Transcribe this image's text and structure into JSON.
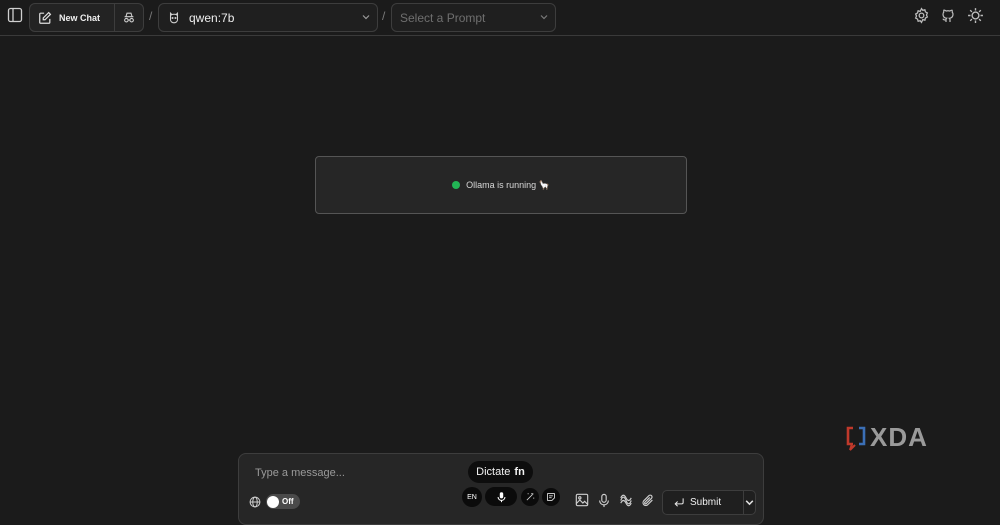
{
  "header": {
    "new_chat_label": "New Chat",
    "separator_1": "/",
    "separator_2": "/",
    "model": {
      "selected": "qwen:7b"
    },
    "prompt_select": {
      "placeholder": "Select a Prompt"
    },
    "right_icons": [
      "gear-icon",
      "github-icon",
      "settings-cog-icon"
    ]
  },
  "status": {
    "text": "Ollama is running 🦙",
    "indicator_color": "#22b455"
  },
  "watermark": {
    "text": "XDA"
  },
  "composer": {
    "placeholder": "Type a message...",
    "web_search_toggle": {
      "label": "Off",
      "state": "off"
    },
    "submit_label": "Submit"
  },
  "dictation": {
    "tooltip_label": "Dictate",
    "tooltip_key": "fn",
    "language": "EN"
  },
  "colors": {
    "background": "#1b1b1b",
    "panel": "#262626",
    "border": "#3d3d3d",
    "accent_green": "#22b455"
  }
}
